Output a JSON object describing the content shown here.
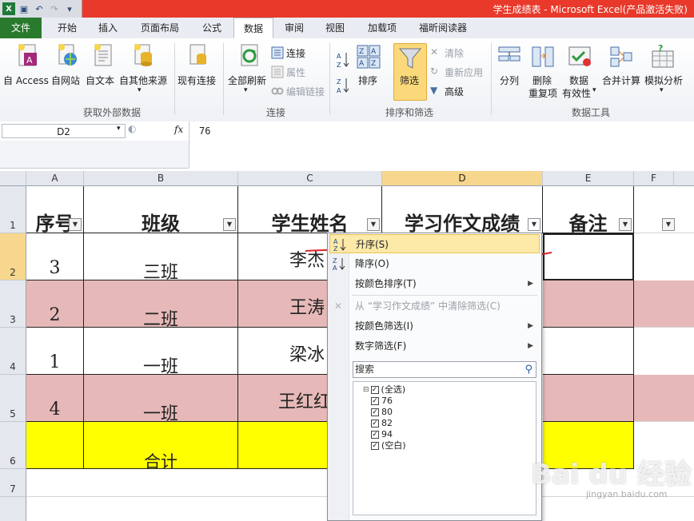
{
  "window": {
    "title": "学生成绩表 - Microsoft Excel(产品激活失败)"
  },
  "qat": {
    "save_icon": "save-icon",
    "undo_icon": "undo-icon",
    "redo_icon": "redo-icon",
    "customize_icon": "customize-icon"
  },
  "tabs": [
    "文件",
    "开始",
    "插入",
    "页面布局",
    "公式",
    "数据",
    "审阅",
    "视图",
    "加载项",
    "福昕阅读器"
  ],
  "active_tab": "数据",
  "ribbon": {
    "get_external": {
      "access": "自 Access",
      "web": "自网站",
      "text": "自文本",
      "other": "自其他来源",
      "existing": "现有连接",
      "group": "获取外部数据"
    },
    "connections": {
      "refresh": "全部刷新",
      "connect": "连接",
      "properties": "属性",
      "edit_links": "编辑链接",
      "group": "连接"
    },
    "sort_filter": {
      "sort": "排序",
      "filter": "筛选",
      "clear": "清除",
      "reapply": "重新应用",
      "advanced": "高级",
      "group": "排序和筛选"
    },
    "data_tools": {
      "split": "分列",
      "remove_dup_1": "删除",
      "remove_dup_2": "重复项",
      "validation_1": "数据",
      "validation_2": "有效性",
      "consolidate": "合并计算",
      "whatif": "模拟分析",
      "group": "数据工具"
    }
  },
  "formula_bar": {
    "name_box": "D2",
    "fx": "fx",
    "value": "76"
  },
  "columns": [
    "A",
    "B",
    "C",
    "D",
    "E",
    "F"
  ],
  "rows": [
    "1",
    "2",
    "3",
    "4",
    "5",
    "6",
    "7"
  ],
  "headers": {
    "a": "序号",
    "b": "班级",
    "c": "学生姓名",
    "d": "学习作文成绩",
    "e": "备注"
  },
  "data": [
    {
      "a": "3",
      "b": "三班",
      "c": "李杰"
    },
    {
      "a": "2",
      "b": "二班",
      "c": "王涛"
    },
    {
      "a": "1",
      "b": "一班",
      "c": "梁冰"
    },
    {
      "a": "4",
      "b": "一班",
      "c": "王红红"
    }
  ],
  "total_label": "合计",
  "menu": {
    "sort_asc": "升序(S)",
    "sort_desc": "降序(O)",
    "sort_by_color": "按颜色排序(T)",
    "clear_filter": "从 “学习作文成绩” 中清除筛选(C)",
    "filter_by_color": "按颜色筛选(I)",
    "number_filter": "数字筛选(F)",
    "search_placeholder": "搜索",
    "items": [
      "(全选)",
      "76",
      "80",
      "82",
      "94",
      "(空白)"
    ]
  },
  "colors": {
    "pink_row": "#e6b9b8",
    "yellow_row": "#ffff00",
    "title_red": "#e8392a",
    "file_tab": "#2a7a2e",
    "highlight": "#fde9a8"
  },
  "watermark": {
    "main": "Bai du 经验",
    "sub": "jingyan.baidu.com"
  }
}
